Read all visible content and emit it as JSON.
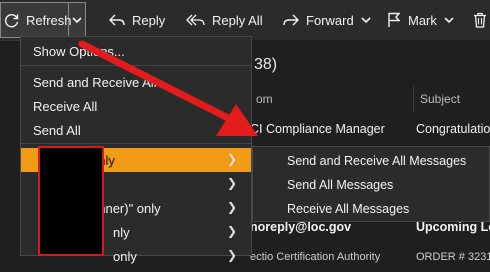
{
  "toolbar": {
    "refresh_label": "Refresh",
    "reply_label": "Reply",
    "reply_all_label": "Reply All",
    "forward_label": "Forward",
    "mark_label": "Mark"
  },
  "list": {
    "count_text": "38)",
    "col_from": "om",
    "col_subject": "Subject",
    "rows": [
      {
        "from": "CI Compliance Manager",
        "subject": "Congratulatio"
      },
      {
        "from": "noreply@loc.gov",
        "subject": "Upcoming Lo"
      },
      {
        "from": "ectio Certification Authority",
        "subject": "ORDER # 3231"
      }
    ]
  },
  "refresh_menu": {
    "items": [
      {
        "label": "Show Options..."
      },
      {
        "label": "Send and Receive All"
      },
      {
        "label": "Receive All"
      },
      {
        "label": "Send All"
      },
      {
        "label": "only"
      },
      {
        "label": ""
      },
      {
        "label": "unner)\" only"
      },
      {
        "label": "nly"
      },
      {
        "label": "only"
      }
    ]
  },
  "submenu": {
    "items": [
      {
        "label": "Send and Receive All Messages"
      },
      {
        "label": "Send All Messages"
      },
      {
        "label": "Receive All Messages"
      }
    ]
  },
  "colors": {
    "highlight": "#f09a16",
    "arrow": "#e21b1b",
    "redaction_border": "#d61a1a"
  }
}
